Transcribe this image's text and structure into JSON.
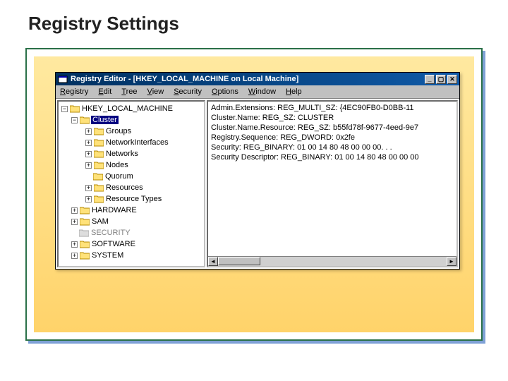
{
  "slide": {
    "title": "Registry Settings"
  },
  "window": {
    "title": "Registry Editor - [HKEY_LOCAL_MACHINE on Local Machine]"
  },
  "menu": {
    "registry": "Registry",
    "edit": "Edit",
    "tree": "Tree",
    "view": "View",
    "security": "Security",
    "options": "Options",
    "window": "Window",
    "help": "Help"
  },
  "tree": {
    "root": "HKEY_LOCAL_MACHINE",
    "cluster": "Cluster",
    "children": [
      "Groups",
      "NetworkInterfaces",
      "Networks",
      "Nodes",
      "Quorum",
      "Resources",
      "Resource Types"
    ],
    "siblings": [
      "HARDWARE",
      "SAM",
      "SECURITY",
      "SOFTWARE",
      "SYSTEM"
    ]
  },
  "values": [
    "Admin.Extensions: REG_MULTI_SZ: {4EC90FB0-D0BB-11",
    "Cluster.Name: REG_SZ: CLUSTER",
    "Cluster.Name.Resource: REG_SZ: b55fd78f-9677-4eed-9e7",
    "Registry.Sequence: REG_DWORD: 0x2fe",
    "Security: REG_BINARY: 01 00 14 80 48 00 00 00. . .",
    "Security Descriptor: REG_BINARY: 01 00 14 80 48 00 00 00"
  ],
  "icons": {
    "minus": "−",
    "plus": "+"
  }
}
